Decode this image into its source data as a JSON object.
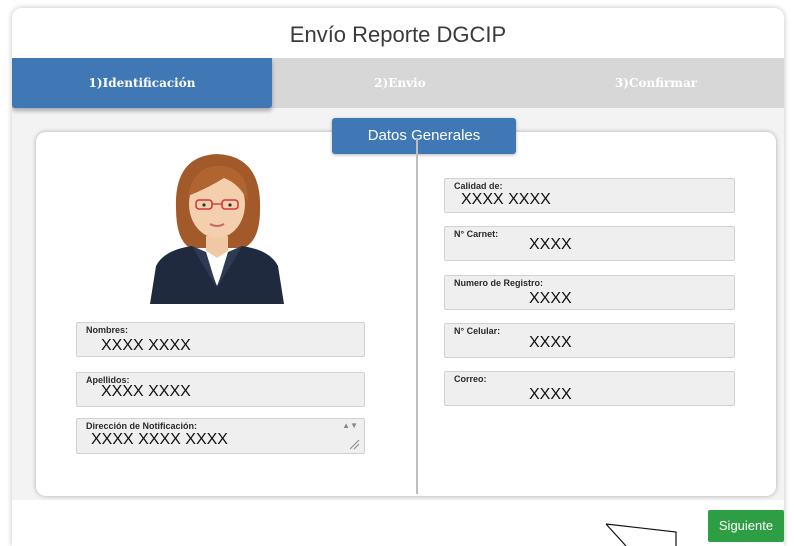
{
  "header": {
    "title": "Envío Reporte DGCIP"
  },
  "tabs": [
    {
      "label": "1)Identificación",
      "active": true
    },
    {
      "label": "2)Envio",
      "active": false
    },
    {
      "label": "3)Confirmar",
      "active": false
    }
  ],
  "section": {
    "title": "Datos Generales"
  },
  "left_fields": {
    "nombres": {
      "label": "Nombres:",
      "value": "XXXX XXXX"
    },
    "apellidos": {
      "label": "Apellidos:",
      "value": "XXXX XXXX"
    },
    "direccion": {
      "label": "Dirección de Notificación:",
      "value": "XXXX XXXX XXXX"
    }
  },
  "right_fields": {
    "calidad": {
      "label": "Calidad de:",
      "value": "XXXX XXXX"
    },
    "carnet": {
      "label": "N° Carnet:",
      "value": "XXXX"
    },
    "registro": {
      "label": "Numero de Registro:",
      "value": "XXXX"
    },
    "celular": {
      "label": "N° Celular:",
      "value": "XXXX"
    },
    "correo": {
      "label": "Correo:",
      "value": "XXXX"
    }
  },
  "footer": {
    "next_label": "Siguiente"
  },
  "icons": {
    "avatar": "woman-avatar-icon",
    "resize": "resize-handle-icon"
  },
  "colors": {
    "accent": "#3f78b5",
    "next": "#2e9e45",
    "tab_inactive": "#d7d7d7"
  }
}
